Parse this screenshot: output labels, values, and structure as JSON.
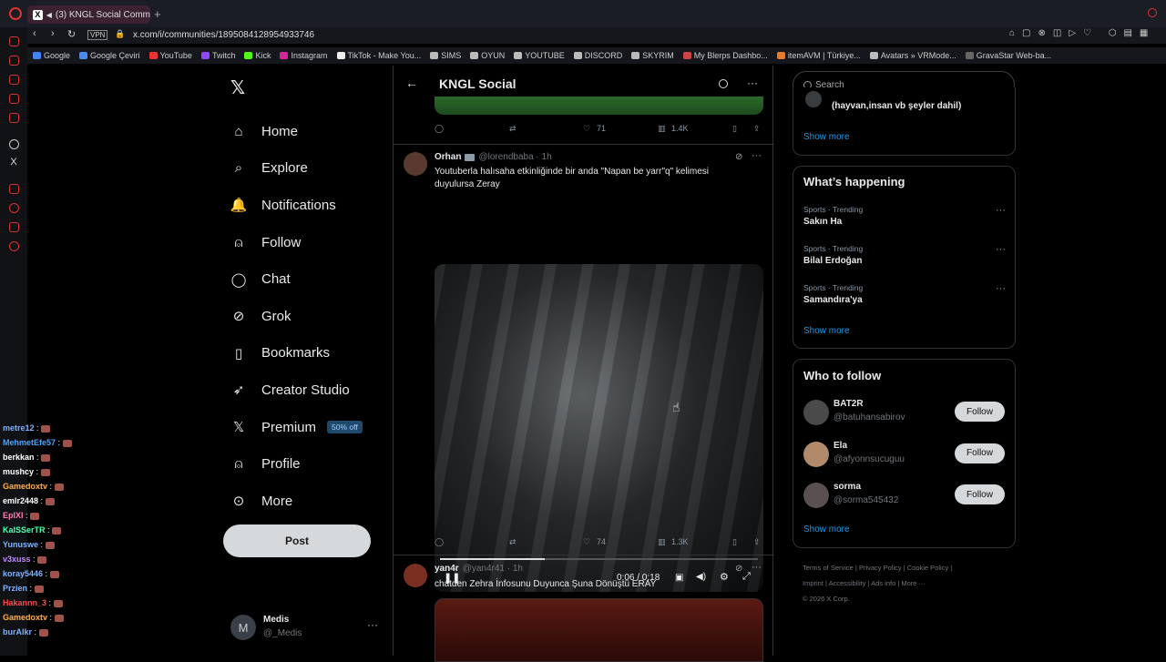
{
  "browser": {
    "tab_title": "(3) KNGL Social Comm",
    "url": "x.com/i/communities/1895084128954933746",
    "vpn_label": "VPN",
    "bookmarks": [
      "Google",
      "Google Çeviri",
      "YouTube",
      "Twitch",
      "Kick",
      "Instagram",
      "TikTok - Make You...",
      "SIMS",
      "OYUN",
      "YOUTUBE",
      "DISCORD",
      "SKYRIM",
      "My Blerps Dashbo...",
      "itemAVM | Türkiye...",
      "Avatars » VRMode...",
      "GravaStar Web-ba..."
    ]
  },
  "sidebar": {
    "items": [
      {
        "label": "Home",
        "icon": "home-icon"
      },
      {
        "label": "Explore",
        "icon": "search-icon"
      },
      {
        "label": "Notifications",
        "icon": "bell-icon"
      },
      {
        "label": "Follow",
        "icon": "person-plus-icon"
      },
      {
        "label": "Chat",
        "icon": "chat-icon"
      },
      {
        "label": "Grok",
        "icon": "grok-icon"
      },
      {
        "label": "Bookmarks",
        "icon": "bookmark-icon"
      },
      {
        "label": "Creator Studio",
        "icon": "rocket-icon"
      },
      {
        "label": "Premium",
        "icon": "x-logo-icon"
      },
      {
        "label": "Profile",
        "icon": "person-icon"
      },
      {
        "label": "More",
        "icon": "more-circle-icon"
      }
    ],
    "premium_badge": "50% off",
    "post_label": "Post",
    "account": {
      "name": "Medis",
      "handle": "@_Medis",
      "avatar_letter": "M"
    }
  },
  "community": {
    "title": "KNGL Social"
  },
  "prev_tweet": {
    "likes": "71",
    "views": "1.4K"
  },
  "tweet1": {
    "name": "Orhan",
    "handle": "@lorendbaba · 1h",
    "text": "Youtuberla halısaha etkinliğinde bir anda \"Napan be yarr\"q\" kelimesi duyulursa Zeray",
    "video_time": "0:06 / 0:18",
    "video_progress": 0.33,
    "likes": "74",
    "views": "1.3K"
  },
  "tweet2": {
    "name": "yan4r",
    "handle": "@yan4r41 · 1h",
    "text": "chatden Zehra İnfosunu Duyunca Şuna Dönüştü ERAY"
  },
  "right": {
    "search_placeholder": "Search",
    "top_card_text": "(hayvan,insan vb şeyler dahil)",
    "show_more": "Show more",
    "happening_title": "What’s happening",
    "trends": [
      {
        "meta": "Sports · Trending",
        "title": "Sakın Ha"
      },
      {
        "meta": "Sports · Trending",
        "title": "Bilal Erdoğan"
      },
      {
        "meta": "Sports · Trending",
        "title": "Samandıra'ya"
      }
    ],
    "wtf_title": "Who to follow",
    "follow_label": "Follow",
    "who_to_follow": [
      {
        "name": "BAT2R",
        "handle": "@batuhansabirov"
      },
      {
        "name": "Ela",
        "handle": "@afyonnsucuguu"
      },
      {
        "name": "sorma",
        "handle": "@sorma545432"
      }
    ],
    "footer1": "Terms of Service | Privacy Policy | Cookie Policy |",
    "footer2": "Imprint | Accessibility | Ads info | More ···",
    "footer3": "© 2026 X Corp."
  },
  "stream_chat": [
    {
      "user": "metre12",
      "color": "#7fb2ff"
    },
    {
      "user": "MehmetEfe57",
      "color": "#4aa3ff"
    },
    {
      "user": "berkkan",
      "color": "#ffffff"
    },
    {
      "user": "mushcy",
      "color": "#ffffff"
    },
    {
      "user": "Gamedoxtv",
      "color": "#ffb04a"
    },
    {
      "user": "emlr2448",
      "color": "#ffffff"
    },
    {
      "user": "EpIXI",
      "color": "#ff7ab0"
    },
    {
      "user": "KaISSerTR",
      "color": "#4affb0"
    },
    {
      "user": "Yunuswe",
      "color": "#7fb2ff"
    },
    {
      "user": "v3xuss",
      "color": "#c08aff"
    },
    {
      "user": "koray5446",
      "color": "#7fb2ff"
    },
    {
      "user": "Przien",
      "color": "#7fb2ff"
    },
    {
      "user": "Hakannn_3",
      "color": "#ff4a4a"
    },
    {
      "user": "Gamedoxtv",
      "color": "#ffb04a"
    },
    {
      "user": "burAlkr",
      "color": "#7fb2ff"
    }
  ]
}
